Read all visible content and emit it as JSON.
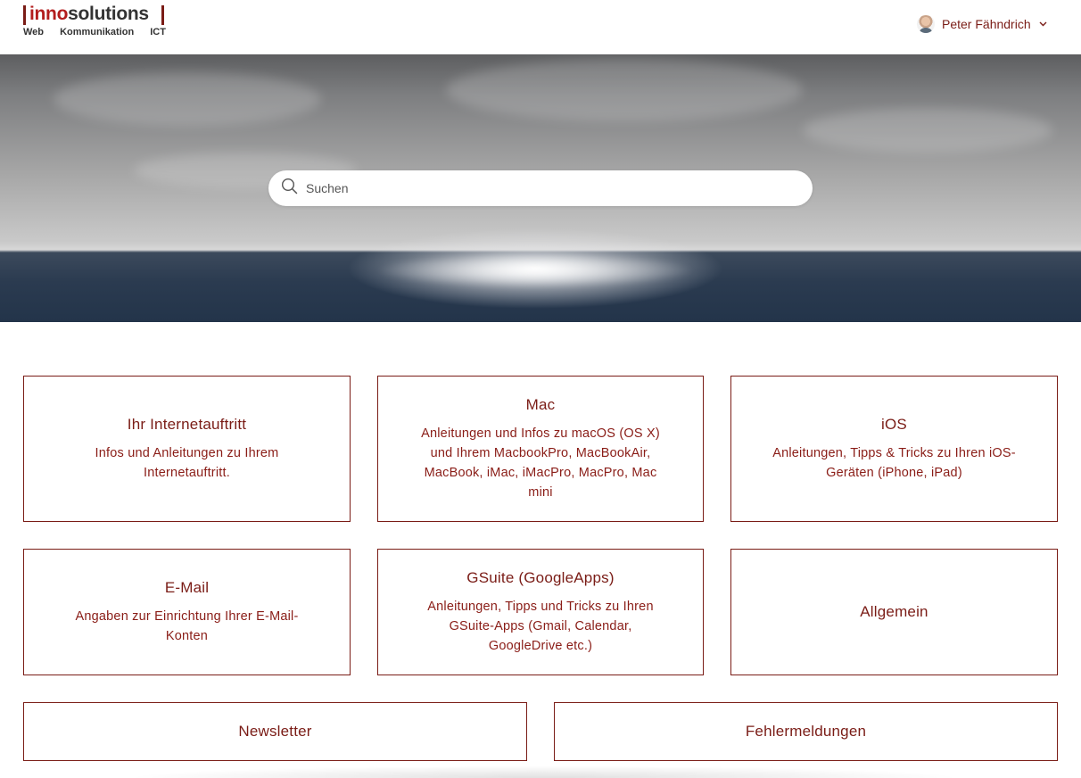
{
  "header": {
    "logo": {
      "brand_prefix": "inno",
      "brand_suffix": "solutions",
      "tagline": [
        "Web",
        "Kommunikation",
        "ICT"
      ]
    },
    "user": {
      "name": "Peter Fähndrich",
      "icon": "chevron-down-icon"
    }
  },
  "hero": {
    "search": {
      "placeholder": "Suchen",
      "icon": "search-icon"
    }
  },
  "categories": [
    {
      "title": "Ihr Internetauftritt",
      "description": "Infos und Anleitungen zu Ihrem Internetauftritt."
    },
    {
      "title": "Mac",
      "description": "Anleitungen und Infos zu macOS (OS X) und Ihrem MacbookPro, MacBookAir, MacBook, iMac, iMacPro, MacPro, Mac mini"
    },
    {
      "title": "iOS",
      "description": "Anleitungen, Tipps & Tricks zu Ihren iOS-Geräten (iPhone, iPad)"
    },
    {
      "title": "E-Mail",
      "description": "Angaben zur Einrichtung Ihrer E-Mail-Konten"
    },
    {
      "title": "GSuite (GoogleApps)",
      "description": "Anleitungen, Tipps und Tricks zu Ihren GSuite-Apps (Gmail, Calendar, GoogleDrive etc.)"
    },
    {
      "title": "Allgemein",
      "description": ""
    },
    {
      "title": "Newsletter",
      "description": ""
    },
    {
      "title": "Fehlermeldungen",
      "description": ""
    }
  ],
  "colors": {
    "accent": "#7a1c16",
    "logo_red": "#b31d1d",
    "background": "#ffffff"
  }
}
